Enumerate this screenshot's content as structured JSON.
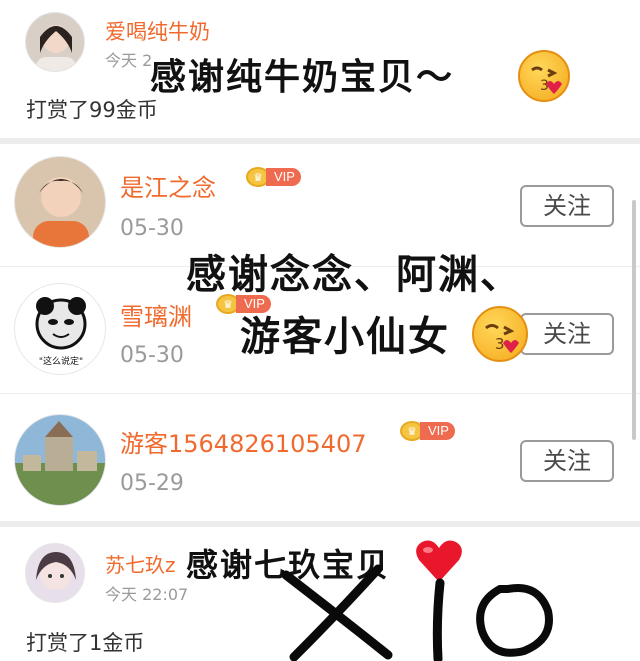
{
  "items": [
    {
      "name": "爱喝纯牛奶",
      "time": "今天 2",
      "reward": "打赏了99金币"
    },
    {
      "name": "是江之念",
      "date": "05-30",
      "badge": "VIP",
      "follow": "关注"
    },
    {
      "name": "雪璃渊",
      "date": "05-30",
      "badge": "VIP",
      "follow": "关注",
      "avatar_caption": "\"这么说定\""
    },
    {
      "name": "游客1564826105407",
      "date": "05-29",
      "badge": "VIP",
      "follow": "关注"
    },
    {
      "name": "苏七玖z",
      "time": "今天 22:07",
      "reward": "打赏了1金币"
    }
  ],
  "overlays": {
    "note1": "感谢纯牛奶宝贝～",
    "note2_line1": "感谢念念、阿渊、",
    "note2_line2": "游客小仙女",
    "note3": "感谢七玖宝贝",
    "signature": "XIO"
  },
  "colors": {
    "name": "#f06a2e",
    "meta": "#9a9a9a",
    "vip": "#ef6b4f",
    "separator": "#ececec"
  },
  "icons": [
    "kissing-face-emoji",
    "heart-emoji",
    "crown-icon"
  ]
}
